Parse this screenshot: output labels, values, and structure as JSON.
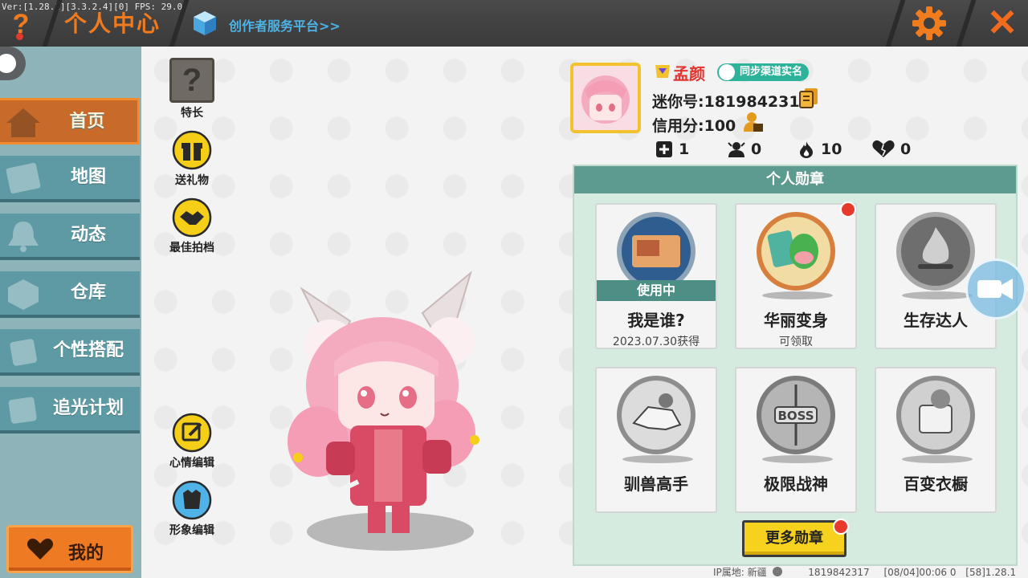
{
  "debug_text": "Ver:[1.28.1][3.3.2.4][0] FPS: 29.0",
  "header": {
    "title": "个人中心",
    "creator_link": "创作者服务平台>>",
    "help_label": "?",
    "close_label": "✕"
  },
  "sidebar": {
    "items": [
      {
        "label": "首页",
        "icon": "house-icon",
        "active": true
      },
      {
        "label": "地图",
        "icon": "map-icon",
        "active": false
      },
      {
        "label": "动态",
        "icon": "bell-icon",
        "active": false
      },
      {
        "label": "仓库",
        "icon": "box-icon",
        "active": false
      },
      {
        "label": "个性搭配",
        "icon": "outfit-icon",
        "active": false
      },
      {
        "label": "追光计划",
        "icon": "light-icon",
        "active": false
      }
    ],
    "mine_label": "我的"
  },
  "actions": {
    "talent": "特长",
    "talent_glyph": "?",
    "send_gift": "送礼物",
    "best_partner": "最佳拍档",
    "mood_edit": "心情编辑",
    "avatar_edit": "形象编辑"
  },
  "profile": {
    "nickname": "孟颜",
    "realname_badge": "同步渠道实名",
    "mini_id": "迷你号:1819842317",
    "credit": "信用分:100",
    "stats": {
      "posts": "1",
      "followers": "0",
      "popularity": "10",
      "likes": "0"
    }
  },
  "medals": {
    "title": "个人勋章",
    "in_use_label": "使用中",
    "items": [
      {
        "name": "我是谁?",
        "sub": "2023.07.30获得",
        "in_use": true
      },
      {
        "name": "华丽变身",
        "sub": "可领取",
        "red_dot": true
      },
      {
        "name": "生存达人",
        "sub": ""
      },
      {
        "name": "驯兽高手",
        "sub": ""
      },
      {
        "name": "极限战神",
        "sub": ""
      },
      {
        "name": "百变衣橱",
        "sub": ""
      }
    ],
    "more_label": "更多勋章"
  },
  "footer": {
    "ip_location": "IP属地: 新疆",
    "id": "1819842317",
    "time": "[08/04]00:06 0",
    "version": "[58]1.28.1"
  },
  "colors": {
    "accent_orange": "#f17a1d",
    "sidebar_teal": "#5e9aa4",
    "panel_green": "#d5ebdf",
    "panel_header": "#5d9a8f",
    "button_yellow": "#f6d21e"
  }
}
